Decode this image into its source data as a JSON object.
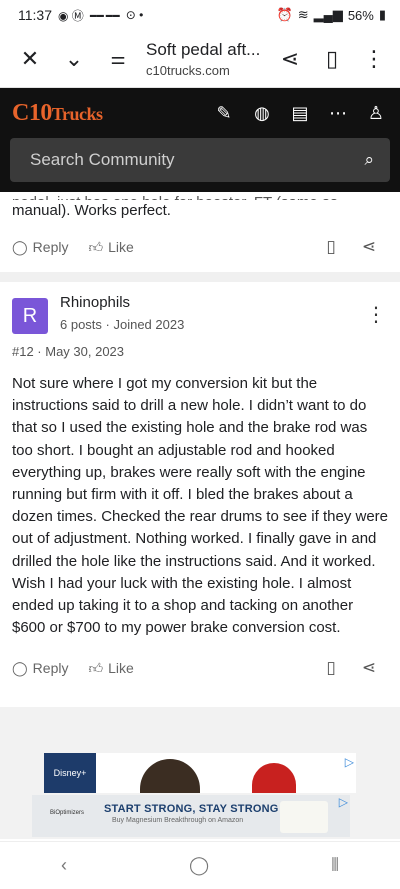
{
  "status_bar": {
    "time": "11:37",
    "battery": "56%"
  },
  "browser": {
    "page_title": "Soft pedal aft...",
    "url": "c10trucks.com"
  },
  "site": {
    "logo": "C10",
    "logo_suffix": "Trucks",
    "search_placeholder": "Search Community"
  },
  "previous_post": {
    "partial_line": "pedal, just has one hole for booster. FT (same as",
    "last_line": "manual). Works perfect.",
    "reply_label": "Reply",
    "like_label": "Like"
  },
  "post": {
    "avatar_letter": "R",
    "author": "Rhinophils",
    "meta": "6 posts · Joined 2023",
    "number_date": "#12 · May 30, 2023",
    "body": "Not sure where I got my conversion kit but the instructions said to drill a new hole. I didn’t want to do that so I used the existing hole and the brake rod was too short. I bought an adjustable rod and hooked everything up, brakes were really soft with the engine running but firm with it off. I bled the brakes about a dozen times. Checked the rear drums to see if they were out of adjustment. Nothing worked. I finally gave in and drilled the hole like the instructions said. And it worked. Wish I had your luck with the existing hole. I almost ended up taking it to a shop and tacking on another $600 or $700 to my power brake conversion cost.",
    "reply_label": "Reply",
    "like_label": "Like"
  },
  "ad": {
    "headline": "START STRONG, STAY STRONG",
    "subline": "Buy Magnesium Breakthrough on Amazon",
    "brand": "BiOptimizers",
    "disney_label": "Disney+"
  },
  "colors": {
    "logo": "#e8642b",
    "header_bg": "#111111",
    "avatar": "#7a56d8"
  }
}
